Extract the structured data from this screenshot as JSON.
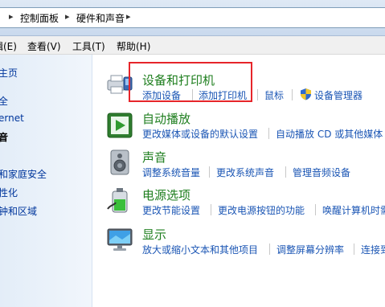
{
  "address": {
    "root": "控制面板",
    "current": "硬件和声音"
  },
  "menu": {
    "edit": "编辑(E)",
    "view": "查看(V)",
    "tools": "工具(T)",
    "help": "帮助(H)"
  },
  "nav": {
    "home": "主页",
    "system": "全",
    "network": "ernet",
    "hardware": "音",
    "family": "和家庭安全",
    "appearance": "性化",
    "region": "钟和区域"
  },
  "categories": {
    "devices": {
      "title": "设备和打印机",
      "links": [
        "添加设备",
        "添加打印机",
        "鼠标",
        "设备管理器"
      ]
    },
    "autoplay": {
      "title": "自动播放",
      "links": [
        "更改媒体或设备的默认设置",
        "自动播放 CD 或其他媒体"
      ]
    },
    "sound": {
      "title": "声音",
      "links": [
        "调整系统音量",
        "更改系统声音",
        "管理音频设备"
      ]
    },
    "power": {
      "title": "电源选项",
      "links": [
        "更改节能设置",
        "更改电源按钮的功能",
        "唤醒计算机时需"
      ]
    },
    "display": {
      "title": "显示",
      "links": [
        "放大或缩小文本和其他项目",
        "调整屏幕分辨率",
        "连接到"
      ]
    }
  },
  "colors": {
    "title_green": "#1e7e1e",
    "link_blue": "#1a55b4",
    "highlight_red": "#e6252a"
  }
}
